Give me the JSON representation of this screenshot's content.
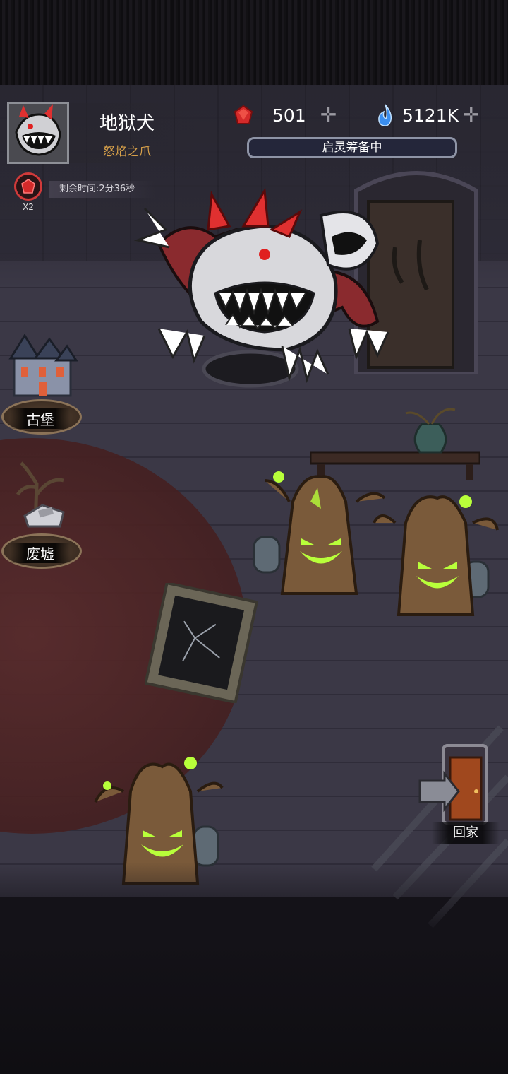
{
  "boss": {
    "name": "地狱犬",
    "skill": "怒焰之爪",
    "multiplier": "X2",
    "timer_text": "剩余时间:2分36秒"
  },
  "resources": {
    "gems": {
      "value": "501",
      "icon": "red-gem-icon",
      "add_icon": "plus-icon"
    },
    "soul_fire": {
      "value": "5121K",
      "icon": "blue-flame-icon",
      "add_icon": "plus-icon"
    }
  },
  "status": {
    "label": "启灵筹备中"
  },
  "locations": [
    {
      "label": "古堡",
      "icon": "castle-icon"
    },
    {
      "label": "废墟",
      "icon": "ruins-icon"
    }
  ],
  "home": {
    "label": "回家",
    "icon": "door-icon"
  },
  "colors": {
    "gem": "#d42a2a",
    "soul_fire": "#3a8ef0",
    "skill_text": "#d8a14a",
    "tree_glow": "#b8ff3a",
    "rage_badge": "#d03a3a"
  }
}
